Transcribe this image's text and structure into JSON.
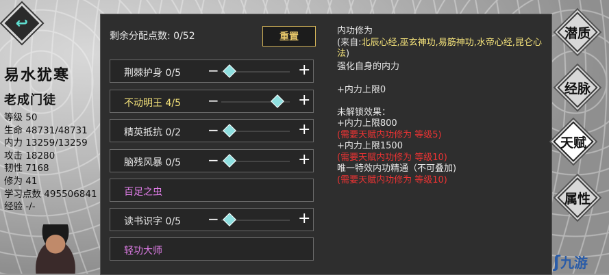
{
  "character": {
    "name": "易水犹寒",
    "title": "老成门徒",
    "stats": [
      "等级 50",
      "生命 48731/48731",
      "内力 13259/13259",
      "攻击 18280",
      "韧性 7168",
      "修为 41",
      "学习点数 495506841",
      "经验 -/-"
    ]
  },
  "panel": {
    "points_label": "剩余分配点数: 0/52",
    "reset_label": "重置",
    "talents": [
      {
        "label": "荆棘护身 0/5",
        "level": 0,
        "max": 5,
        "state": "normal"
      },
      {
        "label": "不动明王 4/5",
        "level": 4,
        "max": 5,
        "state": "active"
      },
      {
        "label": "精英抵抗 0/2",
        "level": 0,
        "max": 2,
        "state": "normal"
      },
      {
        "label": "脑残风暴 0/5",
        "level": 0,
        "max": 5,
        "state": "normal"
      },
      {
        "label": "百足之虫",
        "state": "locked"
      },
      {
        "label": "读书识字 0/5",
        "level": 0,
        "max": 5,
        "state": "normal"
      },
      {
        "label": "轻功大师",
        "state": "locked"
      }
    ]
  },
  "description": {
    "line1": "内功修为",
    "source_prefix": "(来自:",
    "source_list": "北辰心经,巫玄神功,易筋神功,水帝心经,昆仑心法",
    "source_suffix": ")",
    "line3": "强化自身的内力",
    "line4": "+内力上限0",
    "line5": "未解锁效果：",
    "line6": "+内力上限800",
    "line7": "(需要天赋内功修为 等级5)",
    "line8": "+内力上限1500",
    "line9": "(需要天赋内功修为 等级10)",
    "line10": "唯一特效内功精通（不可叠加)",
    "line11": "(需要天赋内功修为 等级10)"
  },
  "tabs": [
    {
      "label": "潜质",
      "selected": false
    },
    {
      "label": "经脉",
      "selected": false
    },
    {
      "label": "天赋",
      "selected": true
    },
    {
      "label": "属性",
      "selected": false
    }
  ],
  "watermark": {
    "text": "九游",
    "logo": "ʃ"
  },
  "icons": {
    "back": "back-arrow-icon"
  },
  "colors": {
    "accent": "#f4e27a",
    "locked": "#e07de8",
    "warning": "#ee3333",
    "knob": "#8fe0e0"
  }
}
